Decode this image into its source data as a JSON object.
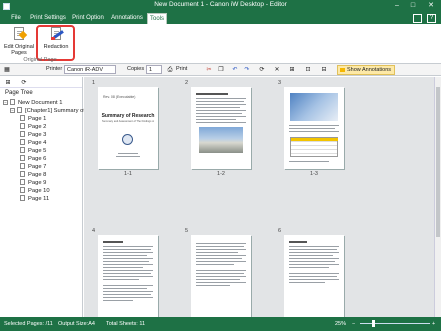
{
  "window": {
    "title": "New Document 1 - Canon iW Desktop - Editor",
    "help": "?",
    "minimize": "–",
    "maximize": "□",
    "close": "✕"
  },
  "tabs": [
    "File",
    "Print Settings",
    "Print Option",
    "Annotations",
    "Tools"
  ],
  "active_tab": "Tools",
  "ribbon": {
    "edit_original_pages": "Edit Original Pages",
    "redaction": "Redaction",
    "group_label": "Original Page"
  },
  "toolbar": {
    "printer_label": "Printer",
    "printer_value": "Canon iR-ADV",
    "copies_label": "Copies",
    "copies_value": "1",
    "print_label": "Print",
    "show_annotations": "Show Annotations"
  },
  "page_tree": {
    "heading": "Page Tree",
    "root": "New Document 1",
    "chapter": "[Chapter1] Summary of ...",
    "pages": [
      "Page 1",
      "Page 2",
      "Page 3",
      "Page 4",
      "Page 5",
      "Page 6",
      "Page 7",
      "Page 8",
      "Page 9",
      "Page 10",
      "Page 11"
    ]
  },
  "thumbnails": [
    {
      "num": "1",
      "label": "1-1"
    },
    {
      "num": "2",
      "label": "1-2"
    },
    {
      "num": "3",
      "label": "1-3"
    },
    {
      "num": "4",
      "label": ""
    },
    {
      "num": "5",
      "label": ""
    },
    {
      "num": "6",
      "label": ""
    }
  ],
  "page1": {
    "small_header": "Rev. 08 (Executable)",
    "title": "Summary of Research",
    "subtitle": "Summary and Assessment of The Findings of the Field"
  },
  "status": {
    "selected_pages": "Selected Pages: /11",
    "output_size": "Output Size:A4",
    "total_sheets": "Total Sheets: 11",
    "zoom": "25%"
  },
  "colors": {
    "titlebar": "#1e7145",
    "highlight": "#e53935",
    "show_annotations_bg": "#fde9a7"
  }
}
